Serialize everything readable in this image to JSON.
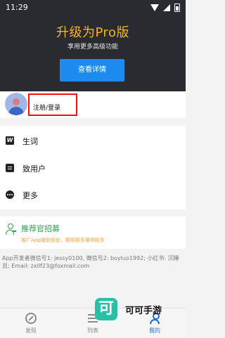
{
  "status_bar": {
    "time": "11:29"
  },
  "pro_banner": {
    "title": "升级为Pro版",
    "subtitle": "享用更多高级功能",
    "button_label": "查看详情"
  },
  "account": {
    "login_label": "注册/登录"
  },
  "menu": {
    "items": [
      {
        "label": "生词",
        "icon": "w-icon"
      },
      {
        "label": "致用户",
        "icon": "chat-icon"
      },
      {
        "label": "更多",
        "icon": "more-icon"
      }
    ]
  },
  "recruit": {
    "title": "推荐官招募",
    "subtitle": "推广App赚取佣金，推得越多赚得越多"
  },
  "developer_info": "App开发者微信号1: jessy0100, 微信号2: boyluo1992; 小红书: 沉睡员; Email: zxllf23@foxmail.com",
  "tabbar": {
    "tabs": [
      {
        "label": "发现"
      },
      {
        "label": "列表"
      },
      {
        "label": "我的"
      }
    ],
    "active_color": "#1d6fe0"
  },
  "watermark": {
    "logo_char": "可",
    "text": "可可手游"
  },
  "colors": {
    "pro_gold": "#f6b51a",
    "primary_blue": "#1d8af0",
    "recruit_green": "#2aa24b"
  }
}
